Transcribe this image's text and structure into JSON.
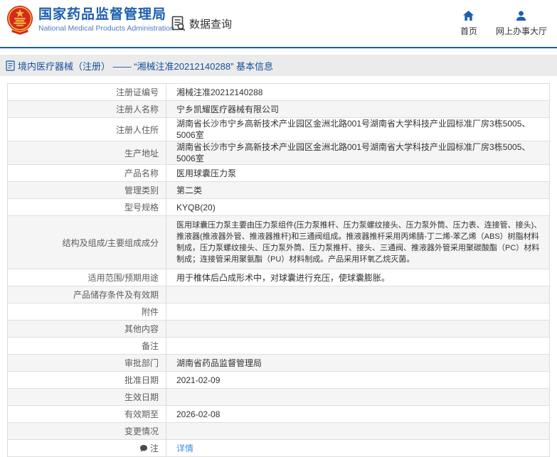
{
  "header": {
    "logo_title": "国家药品监督管理局",
    "logo_subtitle": "National Medical Products Administration",
    "data_query_label": "数据查询",
    "nav_home_label": "首页",
    "nav_hall_label": "网上办事大厅"
  },
  "breadcrumb": {
    "text": "境内医疗器械（注册） —— “湘械注准20212140288” 基本信息"
  },
  "table": {
    "rows": [
      {
        "label": "注册证编号",
        "value": "湘械注准20212140288"
      },
      {
        "label": "注册人名称",
        "value": "宁乡凯耀医疗器械有限公司"
      },
      {
        "label": "注册人住所",
        "value": "湖南省长沙市宁乡高新技术产业园区金洲北路001号湖南省大学科技产业园标准厂房3栋5005、5006室"
      },
      {
        "label": "生产地址",
        "value": "湖南省长沙市宁乡高新技术产业园区金洲北路001号湖南省大学科技产业园标准厂房3栋5005、5006室"
      },
      {
        "label": "产品名称",
        "value": "医用球囊压力泵"
      },
      {
        "label": "管理类别",
        "value": "第二类"
      },
      {
        "label": "型号规格",
        "value": "KYQB(20)"
      },
      {
        "label": "结构及组成/主要组成成分",
        "value": "医用球囊压力泵主要由压力泵组件(压力泵推杆、压力泵螺纹接头、压力泵外筒、压力表、连接管、接头)、推液器(推液器外管、推液器推杆)和三通阀组成。推液器推杆采用丙烯腈-丁二烯-苯乙烯（ABS）树脂材料制成，压力泵螺纹接头、压力泵外筒、压力泵推杆、接头、三通阀、推液器外管采用聚碳酸酯（PC）材料制成；连接管采用聚氨酯（PU）材料制成。产品采用环氧乙烷灭菌。"
      },
      {
        "label": "适用范围/预期用途",
        "value": "用于椎体后凸成形术中，对球囊进行充压，使球囊膨胀。"
      },
      {
        "label": "产品储存条件及有效期",
        "value": ""
      },
      {
        "label": "附件",
        "value": ""
      },
      {
        "label": "其他内容",
        "value": ""
      },
      {
        "label": "备注",
        "value": ""
      },
      {
        "label": "审批部门",
        "value": "湖南省药品监督管理局"
      },
      {
        "label": "批准日期",
        "value": "2021-02-09"
      },
      {
        "label": "生效日期",
        "value": ""
      },
      {
        "label": "有效期至",
        "value": "2026-02-08"
      },
      {
        "label": "变更情况",
        "value": ""
      },
      {
        "label": "注",
        "value": "详情",
        "link": true,
        "icon": "comment-icon"
      }
    ]
  },
  "colors": {
    "accent_blue": "#1d5fae",
    "link_blue": "#3d8fe0",
    "crumb_text_blue": "#15509e",
    "bar_gray": "#ebebeb",
    "alt_row_gray": "#f5f5f5",
    "border_gray": "#dcdcdc",
    "emblem_red": "#d7281e",
    "emblem_gold": "#f2c241"
  }
}
